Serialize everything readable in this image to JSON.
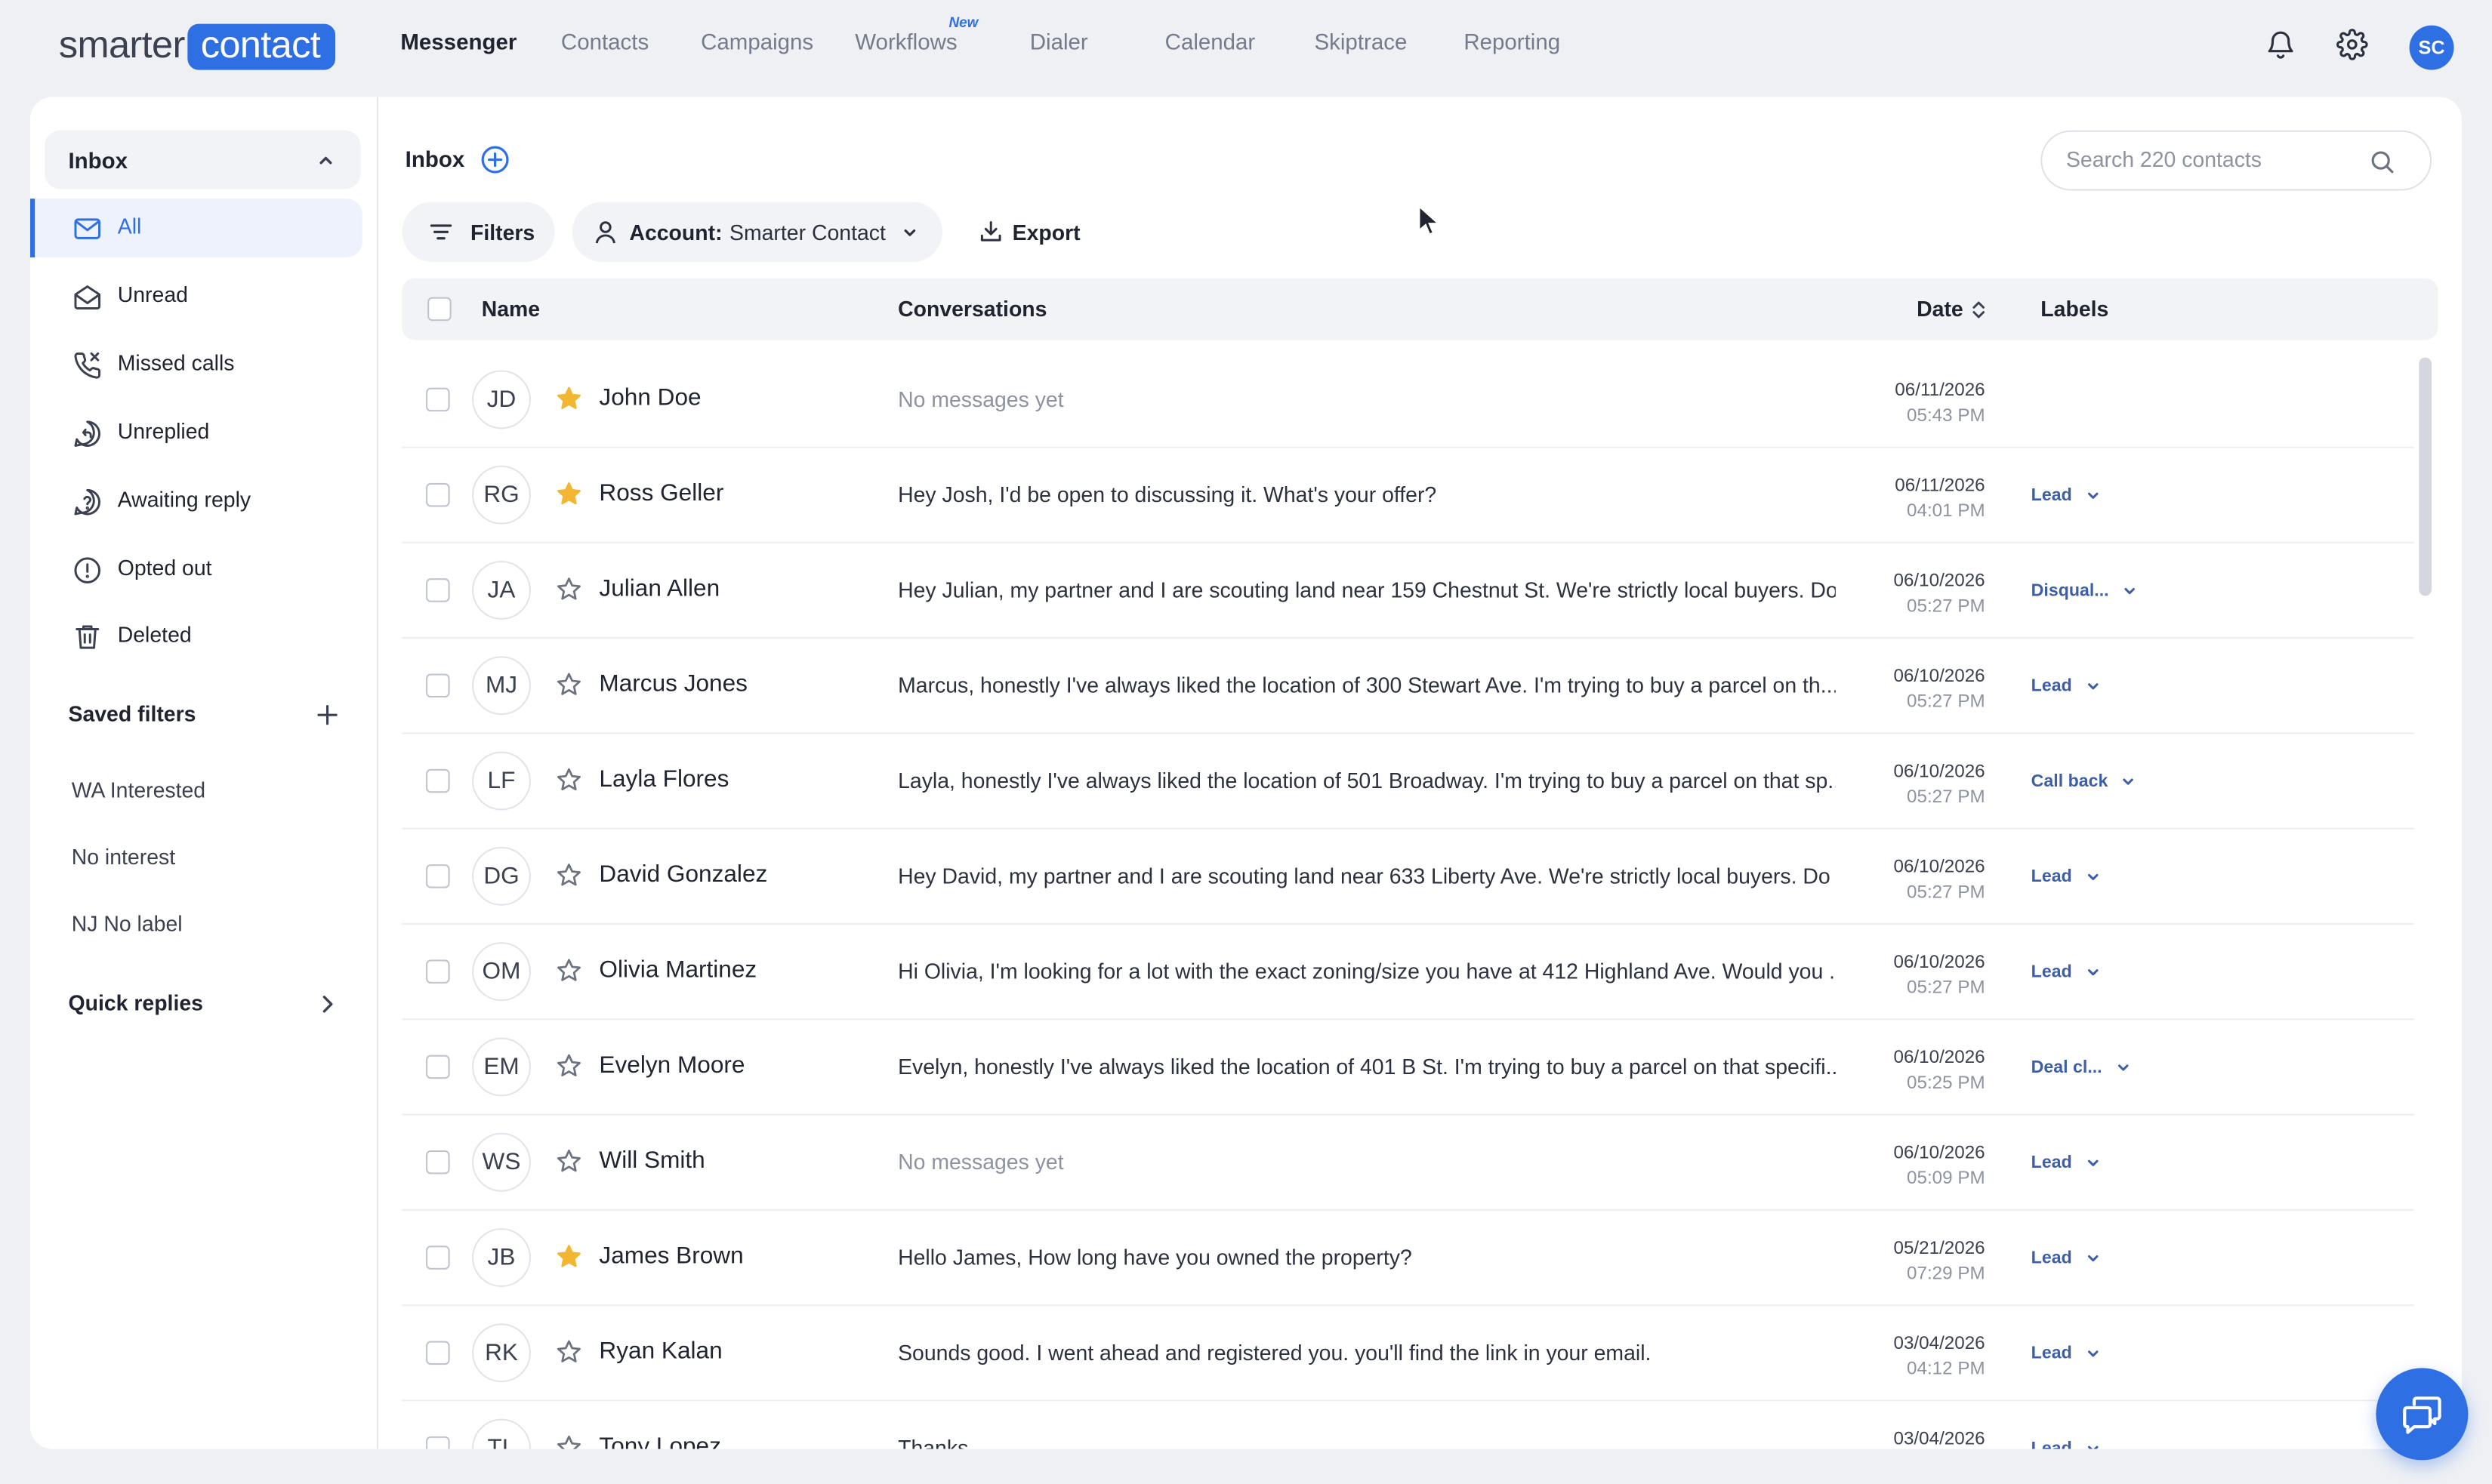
{
  "brand": {
    "part1": "smarter",
    "part2": "contact"
  },
  "nav": {
    "items": [
      {
        "label": "Messenger",
        "active": true
      },
      {
        "label": "Contacts"
      },
      {
        "label": "Campaigns"
      },
      {
        "label": "Workflows",
        "badge": "New"
      },
      {
        "label": "Dialer"
      },
      {
        "label": "Calendar"
      },
      {
        "label": "Skiptrace"
      },
      {
        "label": "Reporting"
      }
    ],
    "avatar_initials": "SC"
  },
  "sidebar": {
    "inbox_label": "Inbox",
    "items": [
      {
        "label": "All",
        "icon": "mail-icon",
        "active": true
      },
      {
        "label": "Unread",
        "icon": "mail-open-icon"
      },
      {
        "label": "Missed calls",
        "icon": "phone-missed-icon"
      },
      {
        "label": "Unreplied",
        "icon": "reply-icon"
      },
      {
        "label": "Awaiting reply",
        "icon": "help-bubble-icon"
      },
      {
        "label": "Opted out",
        "icon": "alert-circle-icon"
      },
      {
        "label": "Deleted",
        "icon": "trash-icon"
      }
    ],
    "saved_filters_title": "Saved filters",
    "saved_filters": [
      "WA Interested",
      "No interest",
      "NJ No label"
    ],
    "quick_replies_title": "Quick replies"
  },
  "main": {
    "title": "Inbox",
    "search_placeholder": "Search 220 contacts",
    "filters_label": "Filters",
    "account_label": "Account:",
    "account_value": "Smarter Contact",
    "export_label": "Export",
    "columns": {
      "name": "Name",
      "conversations": "Conversations",
      "date": "Date",
      "labels": "Labels"
    },
    "rows": [
      {
        "initials": "JD",
        "name": "John Doe",
        "starred": true,
        "message": "No messages yet",
        "empty": true,
        "date": "06/11/2026",
        "time": "05:43 PM",
        "label": ""
      },
      {
        "initials": "RG",
        "name": "Ross Geller",
        "starred": true,
        "message": "Hey Josh, I'd be open to discussing it. What's your offer?",
        "date": "06/11/2026",
        "time": "04:01 PM",
        "label": "Lead"
      },
      {
        "initials": "JA",
        "name": "Julian Allen",
        "starred": false,
        "message": "Hey Julian, my partner and I are scouting land near 159 Chestnut St. We're strictly local buyers. Do...",
        "date": "06/10/2026",
        "time": "05:27 PM",
        "label": "Disqual..."
      },
      {
        "initials": "MJ",
        "name": "Marcus Jones",
        "starred": false,
        "message": "Marcus, honestly I've always liked the location of 300 Stewart Ave. I'm trying to buy a parcel on th...",
        "date": "06/10/2026",
        "time": "05:27 PM",
        "label": "Lead"
      },
      {
        "initials": "LF",
        "name": "Layla Flores",
        "starred": false,
        "message": "Layla, honestly I've always liked the location of 501 Broadway. I'm trying to buy a parcel on that sp...",
        "date": "06/10/2026",
        "time": "05:27 PM",
        "label": "Call back"
      },
      {
        "initials": "DG",
        "name": "David Gonzalez",
        "starred": false,
        "message": "Hey David, my partner and I are scouting land near 633 Liberty Ave. We're strictly local buyers. Do ...",
        "date": "06/10/2026",
        "time": "05:27 PM",
        "label": "Lead"
      },
      {
        "initials": "OM",
        "name": "Olivia Martinez",
        "starred": false,
        "message": "Hi Olivia, I'm looking for a lot with the exact zoning/size you have at 412 Highland Ave. Would you ...",
        "date": "06/10/2026",
        "time": "05:27 PM",
        "label": "Lead"
      },
      {
        "initials": "EM",
        "name": "Evelyn Moore",
        "starred": false,
        "message": "Evelyn, honestly I've always liked the location of 401 B St. I'm trying to buy a parcel on that specifi...",
        "date": "06/10/2026",
        "time": "05:25 PM",
        "label": "Deal cl..."
      },
      {
        "initials": "WS",
        "name": "Will Smith",
        "starred": false,
        "message": "No messages yet",
        "empty": true,
        "date": "06/10/2026",
        "time": "05:09 PM",
        "label": "Lead"
      },
      {
        "initials": "JB",
        "name": "James Brown",
        "starred": true,
        "message": "Hello James, How long have you owned the property?",
        "date": "05/21/2026",
        "time": "07:29 PM",
        "label": "Lead"
      },
      {
        "initials": "RK",
        "name": "Ryan Kalan",
        "starred": false,
        "message": "Sounds good. I went ahead and registered you. you'll find the link in your email.",
        "date": "03/04/2026",
        "time": "04:12 PM",
        "label": "Lead"
      },
      {
        "initials": "TL",
        "name": "Tony Lopez",
        "starred": false,
        "message": "Thanks",
        "date": "03/04/2026",
        "time": "",
        "label": "Lead"
      }
    ]
  },
  "colors": {
    "accent": "#2f6fe4",
    "star": "#f2b632",
    "label_text": "#3d5ea8"
  }
}
